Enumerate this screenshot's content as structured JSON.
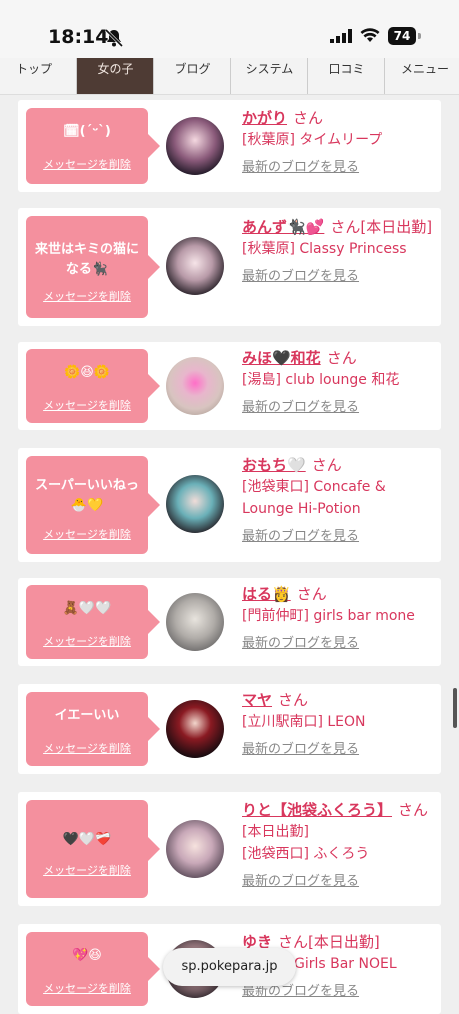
{
  "status_bar": {
    "time": "18:14",
    "battery": "74"
  },
  "tabs": [
    {
      "label": "トップ",
      "active": false
    },
    {
      "label": "女の子",
      "active": true
    },
    {
      "label": "ブログ",
      "active": false
    },
    {
      "label": "システム",
      "active": false
    },
    {
      "label": "口コミ",
      "active": false
    },
    {
      "label": "メニュー",
      "active": false
    }
  ],
  "delete_label": "メッセージを削除",
  "blog_label": "最新のブログを見る",
  "san_label": "さん",
  "cards": [
    {
      "message": "🗓(ˊᵕˋ)",
      "name": "かがり",
      "shop": "[秋葉原] タイムリープ",
      "extra": ""
    },
    {
      "message": "来世はキミの猫になる🐈‍⬛",
      "name": "あんず🐈‍⬛💕",
      "shop": "[秋葉原] Classy Princess",
      "extra": "[本日出勤]"
    },
    {
      "message": "🌼😆🌼",
      "name": "みほ🖤和花",
      "shop": "[湯島] club lounge 和花",
      "extra": ""
    },
    {
      "message": "スーパーいいねっ🐣💛",
      "name": "おもち🤍",
      "shop": "[池袋東口] Concafe & Lounge Hi-Potion",
      "extra": ""
    },
    {
      "message": "🧸🤍🤍",
      "name": "はる👸",
      "shop": "[門前仲町] girls bar mone",
      "extra": ""
    },
    {
      "message": "イエーいい",
      "name": "マヤ",
      "shop": "[立川駅南口] LEON",
      "extra": ""
    },
    {
      "message": "🖤🤍❤️‍🩹",
      "name": "りと【池袋ふくろう】",
      "shop": "[池袋西口] ふくろう",
      "extra": "[本日出勤]"
    },
    {
      "message": "💖😆",
      "name": "ゆき",
      "shop": "Girls Bar NOEL",
      "extra": "[本日出勤]"
    }
  ],
  "url_bar": "sp.pokepara.jp"
}
